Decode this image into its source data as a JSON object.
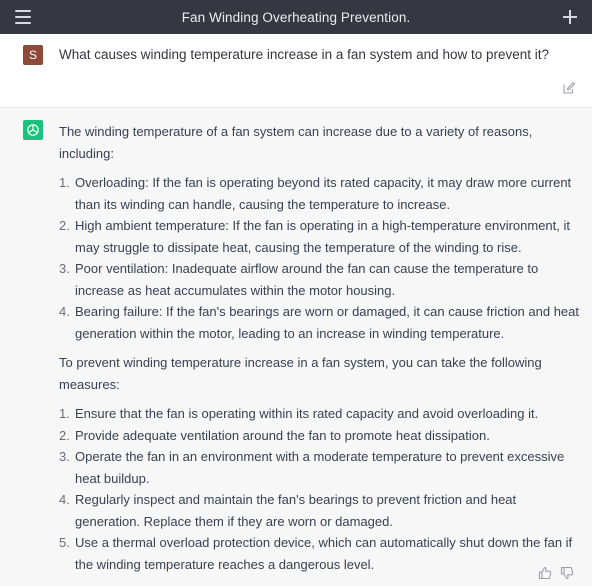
{
  "header": {
    "title": "Fan Winding Overheating Prevention.",
    "menu_icon": "menu-icon",
    "new_chat_icon": "plus-icon"
  },
  "user_message": {
    "avatar_letter": "S",
    "text": "What causes winding temperature increase in a fan system and how to prevent it?",
    "edit_icon": "edit-icon"
  },
  "assistant_message": {
    "intro": "The winding temperature of a fan system can increase due to a variety of reasons, including:",
    "causes": [
      {
        "num": "1.",
        "text": "Overloading: If the fan is operating beyond its rated capacity, it may draw more current than its winding can handle, causing the temperature to increase."
      },
      {
        "num": "2.",
        "text": "High ambient temperature: If the fan is operating in a high-temperature environment, it may struggle to dissipate heat, causing the temperature of the winding to rise."
      },
      {
        "num": "3.",
        "text": "Poor ventilation: Inadequate airflow around the fan can cause the temperature to increase as heat accumulates within the motor housing."
      },
      {
        "num": "4.",
        "text": "Bearing failure: If the fan's bearings are worn or damaged, it can cause friction and heat generation within the motor, leading to an increase in winding temperature."
      }
    ],
    "prevention_intro": "To prevent winding temperature increase in a fan system, you can take the following measures:",
    "measures": [
      {
        "num": "1.",
        "text": "Ensure that the fan is operating within its rated capacity and avoid overloading it."
      },
      {
        "num": "2.",
        "text": "Provide adequate ventilation around the fan to promote heat dissipation."
      },
      {
        "num": "3.",
        "text": "Operate the fan in an environment with a moderate temperature to prevent excessive heat buildup."
      },
      {
        "num": "4.",
        "text": "Regularly inspect and maintain the fan's bearings to prevent friction and heat generation. Replace them if they are worn or damaged."
      },
      {
        "num": "5.",
        "text": "Use a thermal overload protection device, which can automatically shut down the fan if the winding temperature reaches a dangerous level."
      }
    ],
    "thumbs_up_icon": "thumbs-up-icon",
    "thumbs_down_icon": "thumbs-down-icon"
  },
  "colors": {
    "header_bg": "#353741",
    "user_avatar_bg": "#8e4a38",
    "assistant_avatar_bg": "#19c37d",
    "assistant_bg": "#f7f7f8"
  }
}
